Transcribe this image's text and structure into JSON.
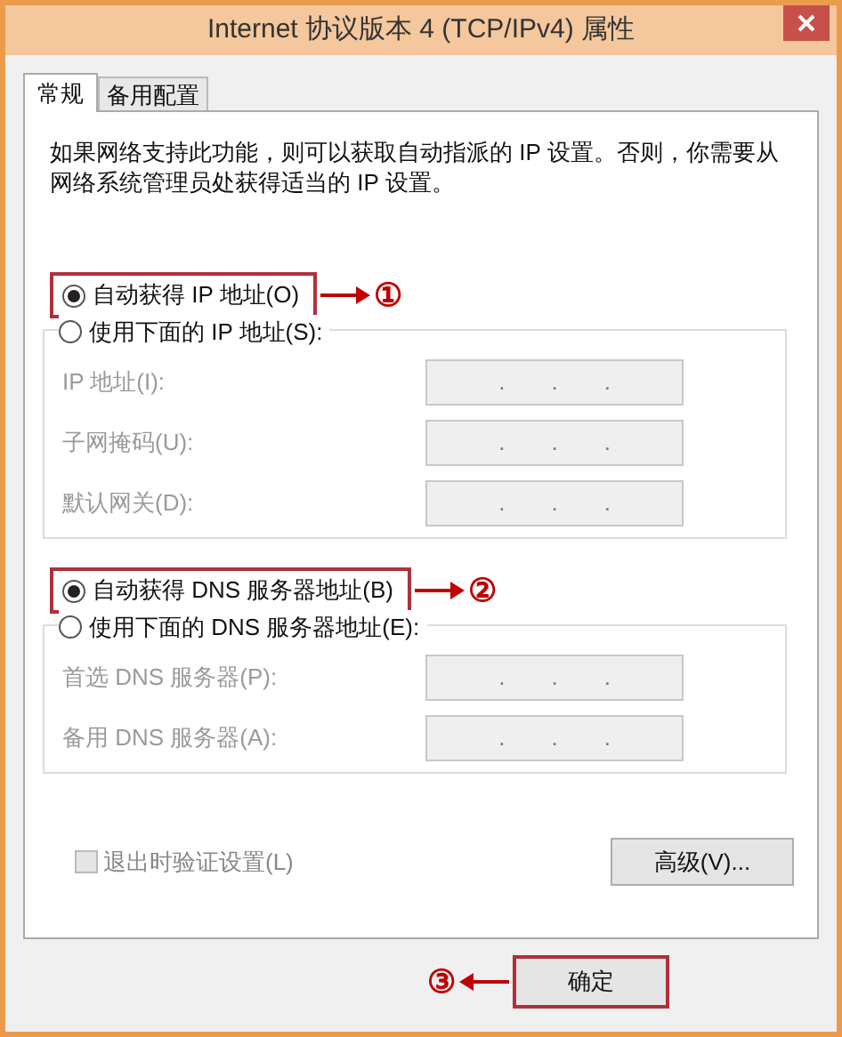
{
  "window": {
    "title": "Internet 协议版本 4 (TCP/IPv4) 属性"
  },
  "tabs": [
    {
      "label": "常规",
      "selected": true
    },
    {
      "label": "备用配置",
      "selected": false
    }
  ],
  "description": "如果网络支持此功能，则可以获取自动指派的 IP 设置。否则，你需要从网络系统管理员处获得适当的 IP 设置。",
  "sections": [
    {
      "auto": {
        "label": "自动获得 IP 地址(O)",
        "selected": true,
        "highlighted": true,
        "callout": "①"
      },
      "manual": {
        "label": "使用下面的 IP 地址(S):",
        "selected": false
      },
      "fields": [
        {
          "label": "IP 地址(I):",
          "dots": [
            ".",
            ".",
            "."
          ],
          "disabled": true
        },
        {
          "label": "子网掩码(U):",
          "dots": [
            ".",
            ".",
            "."
          ],
          "disabled": true
        },
        {
          "label": "默认网关(D):",
          "dots": [
            ".",
            ".",
            "."
          ],
          "disabled": true
        }
      ]
    },
    {
      "auto": {
        "label": "自动获得 DNS 服务器地址(B)",
        "selected": true,
        "highlighted": true,
        "callout": "②"
      },
      "manual": {
        "label": "使用下面的 DNS 服务器地址(E):",
        "selected": false
      },
      "fields": [
        {
          "label": "首选 DNS 服务器(P):",
          "dots": [
            ".",
            ".",
            "."
          ],
          "disabled": true
        },
        {
          "label": "备用 DNS 服务器(A):",
          "dots": [
            ".",
            ".",
            "."
          ],
          "disabled": true
        }
      ]
    }
  ],
  "validate": {
    "label": "退出时验证设置(L)",
    "checked": false,
    "disabled": true
  },
  "advanced_button": "高级(V)...",
  "ok_button": {
    "label": "确定",
    "highlighted": true,
    "callout": "③"
  }
}
